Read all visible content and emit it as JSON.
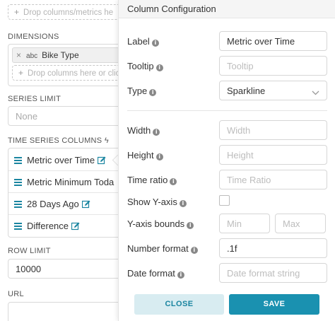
{
  "left_panel": {
    "metrics_drop_placeholder": "Drop columns/metrics he",
    "dimensions_label": "DIMENSIONS",
    "dimension_tag": {
      "type": "abc",
      "label": "Bike Type"
    },
    "dimensions_drop_placeholder": "Drop columns here or clic",
    "series_limit_label": "SERIES LIMIT",
    "series_limit_value": "None",
    "time_series_label": "TIME SERIES COLUMNS",
    "time_series_items": [
      {
        "label": "Metric over Time",
        "editable": true
      },
      {
        "label": "Metric Minimum Toda",
        "editable": false
      },
      {
        "label": "28 Days Ago",
        "editable": true
      },
      {
        "label": "Difference",
        "editable": true
      }
    ],
    "row_limit_label": "ROW LIMIT",
    "row_limit_value": "10000",
    "url_label": "URL"
  },
  "popover": {
    "title": "Column Configuration",
    "label_label": "Label",
    "label_value": "Metric over Time",
    "tooltip_label": "Tooltip",
    "tooltip_placeholder": "Tooltip",
    "type_label": "Type",
    "type_value": "Sparkline",
    "width_label": "Width",
    "width_placeholder": "Width",
    "height_label": "Height",
    "height_placeholder": "Height",
    "time_ratio_label": "Time ratio",
    "time_ratio_placeholder": "Time Ratio",
    "show_y_axis_label": "Show Y-axis",
    "show_y_axis_checked": false,
    "y_axis_bounds_label": "Y-axis bounds",
    "min_placeholder": "Min",
    "max_placeholder": "Max",
    "number_format_label": "Number format",
    "number_format_value": ".1f",
    "date_format_label": "Date format",
    "date_format_placeholder": "Date format string",
    "close_label": "CLOSE",
    "save_label": "SAVE"
  },
  "colors": {
    "accent": "#1a91b0",
    "accent_light": "#d8ecf1"
  }
}
